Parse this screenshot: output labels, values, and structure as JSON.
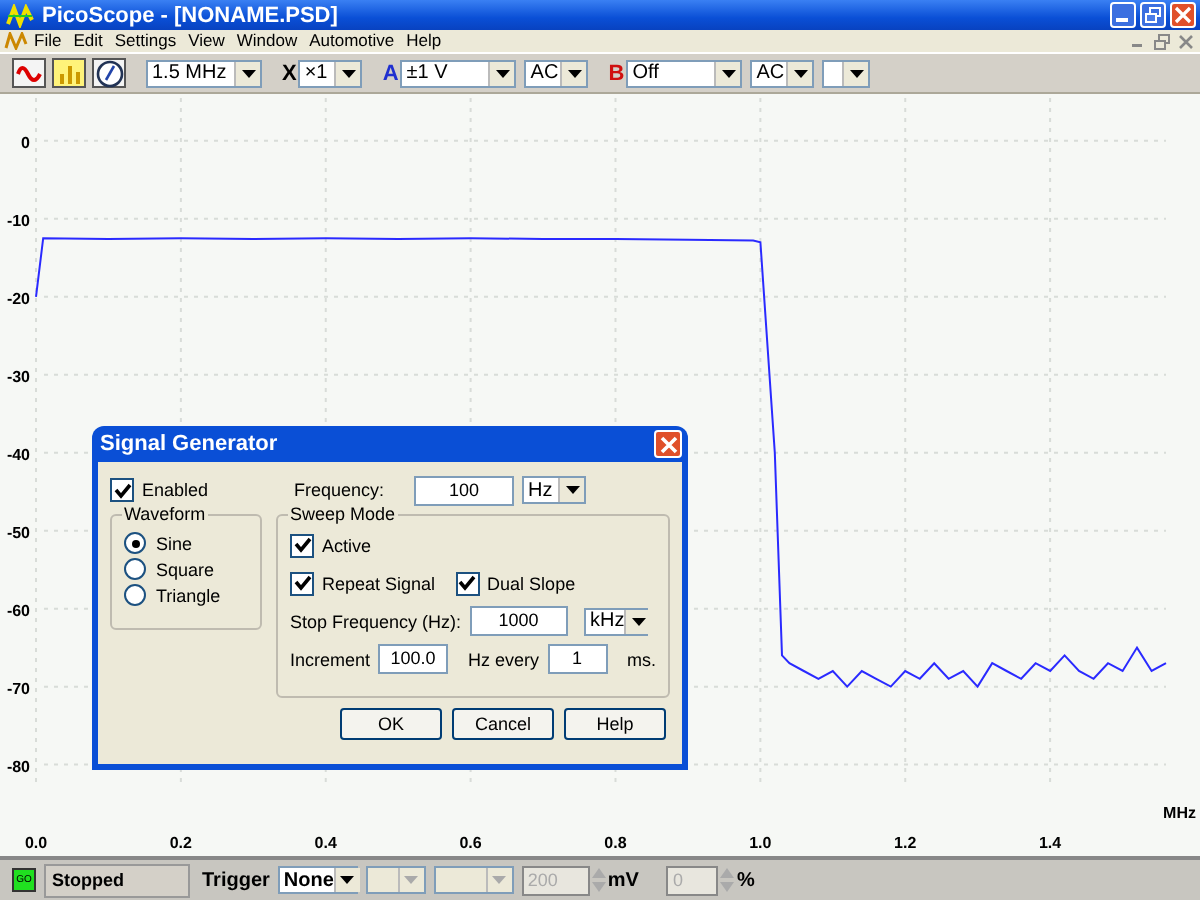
{
  "window": {
    "title": "PicoScope - [NONAME.PSD]"
  },
  "menu": [
    "File",
    "Edit",
    "Settings",
    "View",
    "Window",
    "Automotive",
    "Help"
  ],
  "toolbar": {
    "timebase": "1.5 MHz",
    "x_label": "X",
    "multiplier": "×1",
    "channel_a": {
      "label": "A",
      "range": "±1 V",
      "coupling": "AC"
    },
    "channel_b": {
      "label": "B",
      "range": "Off",
      "coupling": "AC"
    }
  },
  "chart": {
    "chart_data": {
      "type": "line",
      "grid": true,
      "xlabel": "MHz",
      "xlim": [
        0,
        1.56
      ],
      "ylim": [
        -83,
        6
      ],
      "xticks": [
        {
          "value": 0,
          "label": "0.0"
        },
        {
          "value": 0.2,
          "label": "0.2"
        },
        {
          "value": 0.4,
          "label": "0.4"
        },
        {
          "value": 0.6,
          "label": "0.6"
        },
        {
          "value": 0.8,
          "label": "0.8"
        },
        {
          "value": 1,
          "label": "1.0"
        },
        {
          "value": 1.2,
          "label": "1.2"
        },
        {
          "value": 1.4,
          "label": "1.4"
        }
      ],
      "yticks": [
        0,
        -10,
        -20,
        -30,
        -40,
        -50,
        -60,
        -70,
        -80
      ],
      "x": [
        0,
        0.01,
        0.1,
        0.2,
        0.3,
        0.4,
        0.5,
        0.6,
        0.7,
        0.8,
        0.9,
        0.99,
        1.0,
        1.02,
        1.03,
        1.04,
        1.06,
        1.08,
        1.1,
        1.12,
        1.14,
        1.16,
        1.18,
        1.2,
        1.22,
        1.24,
        1.26,
        1.28,
        1.3,
        1.32,
        1.34,
        1.36,
        1.38,
        1.4,
        1.42,
        1.44,
        1.46,
        1.48,
        1.5,
        1.52,
        1.54,
        1.56
      ],
      "values": [
        -20,
        -12.5,
        -12.6,
        -12.5,
        -12.6,
        -12.5,
        -12.6,
        -12.5,
        -12.6,
        -12.6,
        -12.7,
        -12.8,
        -13,
        -40,
        -66,
        -67,
        -68,
        -69,
        -68,
        -70,
        -68,
        -69,
        -70,
        -68,
        -69,
        -67,
        -69,
        -68,
        -70,
        -67,
        -68,
        -69,
        -67,
        -68,
        -66,
        -68,
        -69,
        -67,
        -68,
        -65,
        -68,
        -67
      ]
    }
  },
  "dialog": {
    "title": "Signal Generator",
    "enabled": {
      "label": "Enabled",
      "checked": true
    },
    "frequency": {
      "label": "Frequency:",
      "value": "100",
      "unit": "Hz"
    },
    "waveform": {
      "title": "Waveform",
      "options": [
        {
          "label": "Sine",
          "selected": true
        },
        {
          "label": "Square",
          "selected": false
        },
        {
          "label": "Triangle",
          "selected": false
        }
      ]
    },
    "sweep": {
      "title": "Sweep Mode",
      "active": {
        "label": "Active",
        "checked": true
      },
      "repeat": {
        "label": "Repeat Signal",
        "checked": true
      },
      "dual_slope": {
        "label": "Dual Slope",
        "checked": true
      },
      "stop_label": "Stop Frequency (Hz):",
      "stop_value": "1000",
      "stop_unit": "kHz",
      "increment_label": "Increment",
      "increment_value": "100.0",
      "every_label": "Hz every",
      "every_value": "1",
      "every_unit": "ms."
    },
    "buttons": [
      "OK",
      "Cancel",
      "Help"
    ]
  },
  "status_bar": {
    "go": "GO",
    "state": "Stopped",
    "trigger_label": "Trigger",
    "trigger_mode": "None",
    "level": {
      "value": "200",
      "unit": "mV",
      "disabled": true
    },
    "percent": {
      "value": "0",
      "unit": "%",
      "disabled": true
    }
  }
}
